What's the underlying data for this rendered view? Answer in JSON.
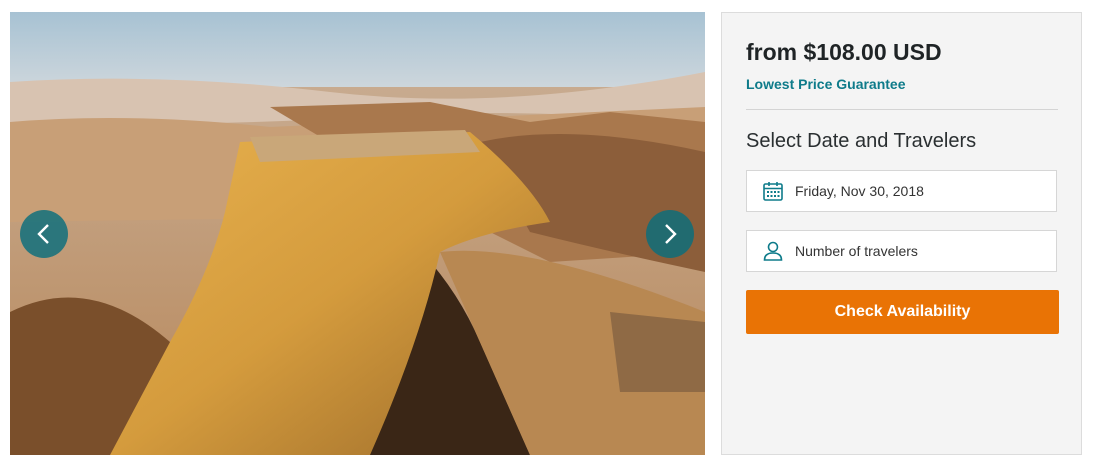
{
  "carousel": {
    "prev_icon": "chevron-left-icon",
    "next_icon": "chevron-right-icon",
    "nav_color": "#0a6e7d"
  },
  "booking": {
    "price": "from $108.00 USD",
    "guarantee": "Lowest Price Guarantee",
    "section_title": "Select Date and Travelers",
    "date_value": "Friday, Nov 30, 2018",
    "date_icon": "calendar-icon",
    "travelers_placeholder": "Number of travelers",
    "travelers_icon": "person-icon",
    "check_label": "Check Availability"
  },
  "colors": {
    "accent_teal": "#0e7b8a",
    "cta_orange": "#e97305",
    "panel_bg": "#f4f4f4"
  }
}
